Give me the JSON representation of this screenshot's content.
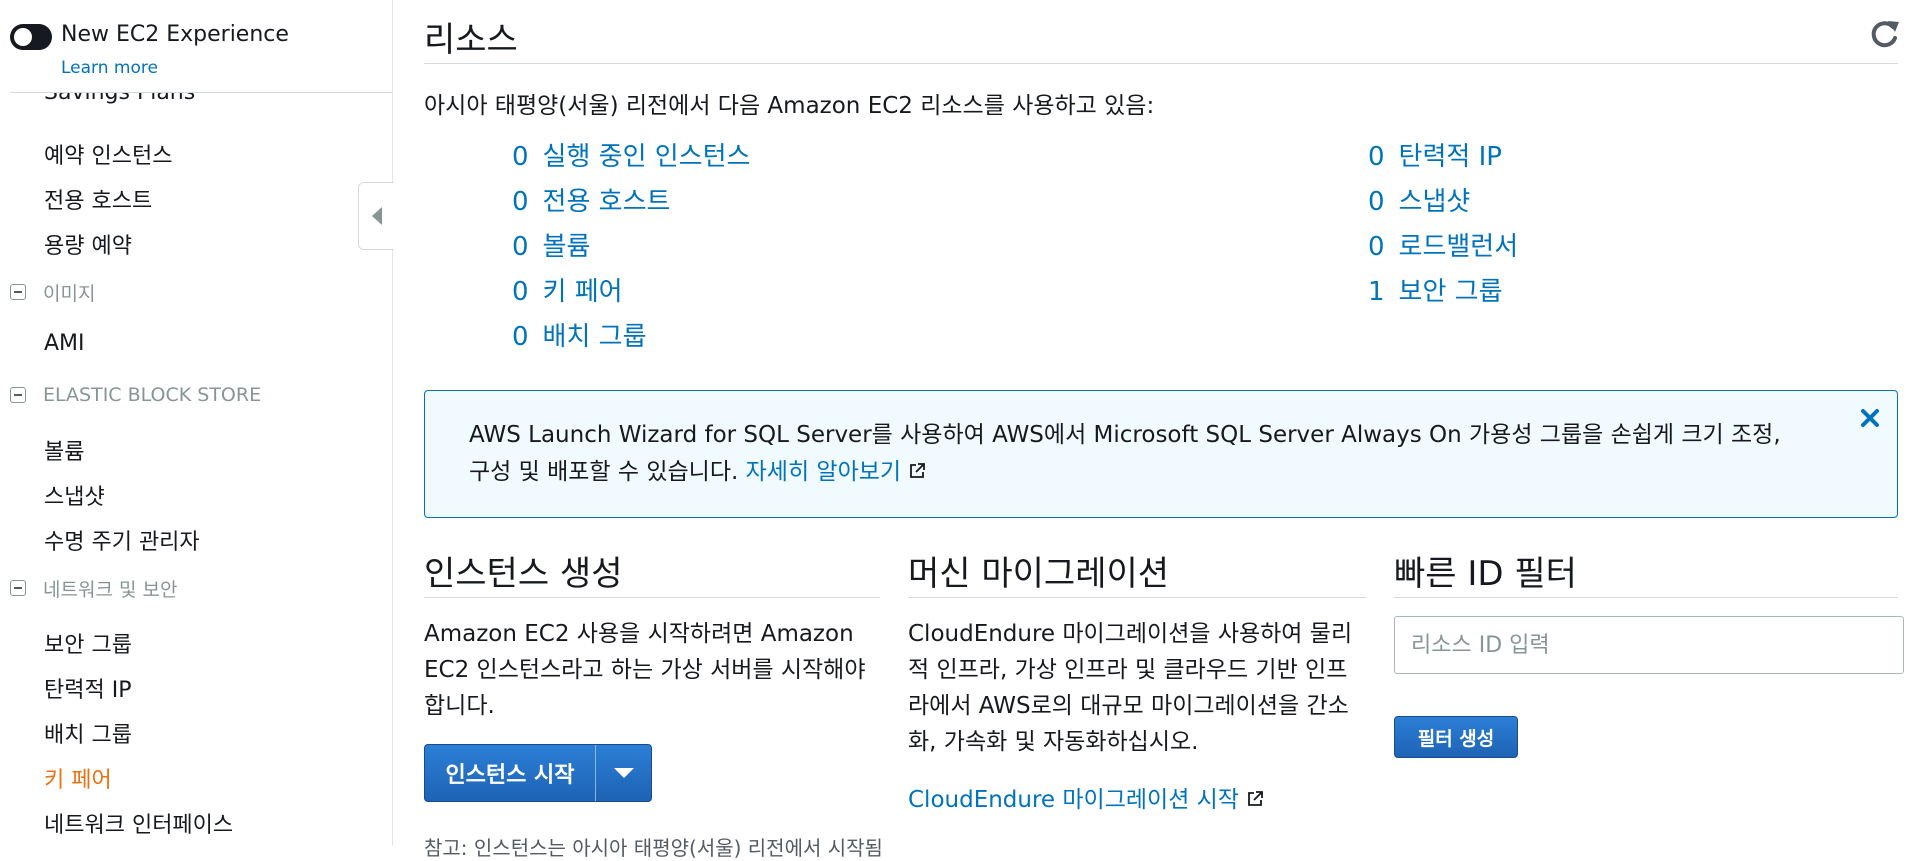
{
  "sidebar": {
    "experience_toggle": {
      "title": "New EC2 Experience",
      "link": "Learn more"
    },
    "partial_item": "Savings Plans",
    "items_top": [
      "예약 인스턴스",
      "전용 호스트",
      "용량 예약"
    ],
    "section_images": "이미지",
    "items_images": [
      "AMI"
    ],
    "section_ebs": "ELASTIC BLOCK STORE",
    "items_ebs": [
      "볼륨",
      "스냅샷",
      "수명 주기 관리자"
    ],
    "section_network": "네트워크 및 보안",
    "items_network": [
      "보안 그룹",
      "탄력적 IP",
      "배치 그룹",
      "키 페어",
      "네트워크 인터페이스"
    ],
    "active_item": "키 페어",
    "active_color": "#ec7211"
  },
  "main": {
    "title": "리소스",
    "region_text": "아시아 태평양(서울) 리전에서 다음 Amazon EC2 리소스를 사용하고 있음:",
    "resources_left": [
      {
        "count": "0",
        "label": "실행 중인 인스턴스"
      },
      {
        "count": "0",
        "label": "전용 호스트"
      },
      {
        "count": "0",
        "label": "볼륨"
      },
      {
        "count": "0",
        "label": "키 페어"
      },
      {
        "count": "0",
        "label": "배치 그룹"
      }
    ],
    "resources_right": [
      {
        "count": "0",
        "label": "탄력적 IP"
      },
      {
        "count": "0",
        "label": "스냅샷"
      },
      {
        "count": "0",
        "label": "로드밸런서"
      },
      {
        "count": "1",
        "label": "보안 그룹"
      }
    ],
    "link_color": "#0073bb"
  },
  "alert": {
    "text": "AWS Launch Wizard for SQL Server를 사용하여 AWS에서 Microsoft SQL Server Always On 가용성 그룹을 손쉽게 크기 조정, 구성 및 배포할 수 있습니다.",
    "link": "자세히 알아보기"
  },
  "create_instance": {
    "title": "인스턴스 생성",
    "body": "Amazon EC2 사용을 시작하려면 Amazon EC2 인스턴스라고 하는 가상 서버를 시작해야 합니다.",
    "button": "인스턴스 시작",
    "note": "참고: 인스턴스는 아시아 태평양(서울) 리전에서 시작됨"
  },
  "migration": {
    "title": "머신 마이그레이션",
    "body": "CloudEndure 마이그레이션을 사용하여 물리적 인프라, 가상 인프라 및 클라우드 기반 인프라에서 AWS로의 대규모 마이그레이션을 간소화, 가속화 및 자동화하십시오.",
    "link": "CloudEndure 마이그레이션 시작"
  },
  "quick_filter": {
    "title": "빠른 ID 필터",
    "placeholder": "리소스 ID 입력",
    "button": "필터 생성"
  },
  "icons": [
    "toggle-icon",
    "collapse-icon",
    "refresh-icon",
    "external-link-icon",
    "close-icon",
    "chevron-down-icon"
  ]
}
